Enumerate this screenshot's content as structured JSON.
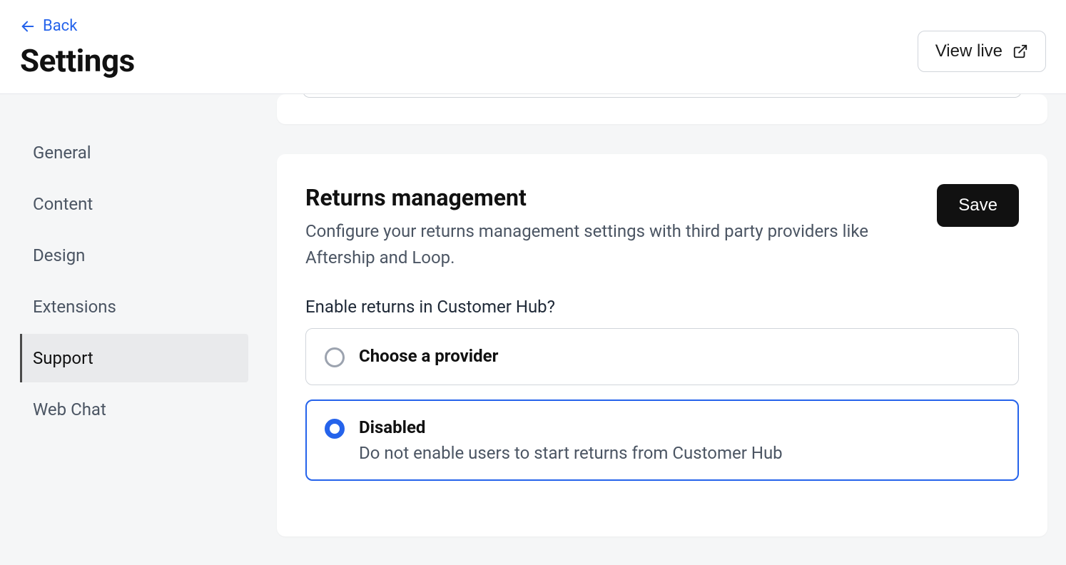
{
  "header": {
    "back_label": "Back",
    "title": "Settings",
    "view_live_label": "View live"
  },
  "sidebar": {
    "items": [
      {
        "label": "General",
        "active": false
      },
      {
        "label": "Content",
        "active": false
      },
      {
        "label": "Design",
        "active": false
      },
      {
        "label": "Extensions",
        "active": false
      },
      {
        "label": "Support",
        "active": true
      },
      {
        "label": "Web Chat",
        "active": false
      }
    ]
  },
  "returns_card": {
    "title": "Returns management",
    "description": "Configure your returns management settings with third party providers like Aftership and Loop.",
    "save_label": "Save",
    "field_label": "Enable returns in Customer Hub?",
    "options": [
      {
        "label": "Choose a provider",
        "sub": "",
        "selected": false
      },
      {
        "label": "Disabled",
        "sub": "Do not enable users to start returns from Customer Hub",
        "selected": true
      }
    ]
  }
}
